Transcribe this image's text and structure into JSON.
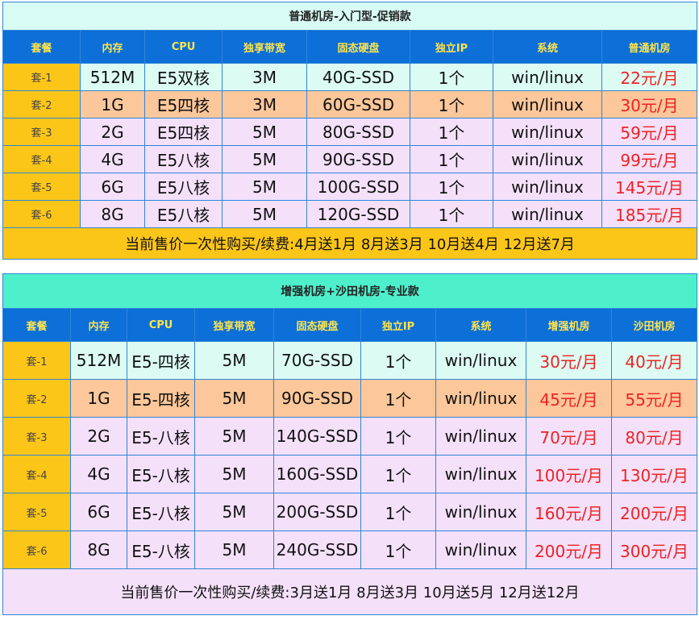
{
  "section1": {
    "title": "普通机房-入门型-促销款",
    "headers": [
      "套餐",
      "内存",
      "CPU",
      "独享带宽",
      "固态硬盘",
      "独立IP",
      "系统",
      "普通机房"
    ],
    "rows": [
      {
        "pkg": "套-1",
        "mem": "512M",
        "cpu": "E5双核",
        "bw": "3M",
        "disk": "40G-SSD",
        "ip": "1个",
        "os": "win/linux",
        "price": "22元/月"
      },
      {
        "pkg": "套-2",
        "mem": "1G",
        "cpu": "E5四核",
        "bw": "3M",
        "disk": "60G-SSD",
        "ip": "1个",
        "os": "win/linux",
        "price": "30元/月"
      },
      {
        "pkg": "套-3",
        "mem": "2G",
        "cpu": "E5四核",
        "bw": "5M",
        "disk": "80G-SSD",
        "ip": "1个",
        "os": "win/linux",
        "price": "59元/月"
      },
      {
        "pkg": "套-4",
        "mem": "4G",
        "cpu": "E5八核",
        "bw": "5M",
        "disk": "90G-SSD",
        "ip": "1个",
        "os": "win/linux",
        "price": "99元/月"
      },
      {
        "pkg": "套-5",
        "mem": "6G",
        "cpu": "E5八核",
        "bw": "5M",
        "disk": "100G-SSD",
        "ip": "1个",
        "os": "win/linux",
        "price": "145元/月"
      },
      {
        "pkg": "套-6",
        "mem": "8G",
        "cpu": "E5八核",
        "bw": "5M",
        "disk": "120G-SSD",
        "ip": "1个",
        "os": "win/linux",
        "price": "185元/月"
      }
    ],
    "footer": "当前售价一次性购买/续费:4月送1月 8月送3月 10月送4月 12月送7月"
  },
  "section2": {
    "title": "增强机房+沙田机房-专业款",
    "headers": [
      "套餐",
      "内存",
      "CPU",
      "独享带宽",
      "固态硬盘",
      "独立IP",
      "系统",
      "增强机房",
      "沙田机房"
    ],
    "rows": [
      {
        "pkg": "套-1",
        "mem": "512M",
        "cpu": "E5-四核",
        "bw": "5M",
        "disk": "70G-SSD",
        "ip": "1个",
        "os": "win/linux",
        "price_a": "30元/月",
        "price_b": "40元/月"
      },
      {
        "pkg": "套-2",
        "mem": "1G",
        "cpu": "E5-四核",
        "bw": "5M",
        "disk": "90G-SSD",
        "ip": "1个",
        "os": "win/linux",
        "price_a": "45元/月",
        "price_b": "55元/月"
      },
      {
        "pkg": "套-3",
        "mem": "2G",
        "cpu": "E5-八核",
        "bw": "5M",
        "disk": "140G-SSD",
        "ip": "1个",
        "os": "win/linux",
        "price_a": "70元/月",
        "price_b": "80元/月"
      },
      {
        "pkg": "套-4",
        "mem": "4G",
        "cpu": "E5-八核",
        "bw": "5M",
        "disk": "160G-SSD",
        "ip": "1个",
        "os": "win/linux",
        "price_a": "100元/月",
        "price_b": "130元/月"
      },
      {
        "pkg": "套-5",
        "mem": "6G",
        "cpu": "E5-八核",
        "bw": "5M",
        "disk": "200G-SSD",
        "ip": "1个",
        "os": "win/linux",
        "price_a": "160元/月",
        "price_b": "200元/月"
      },
      {
        "pkg": "套-6",
        "mem": "8G",
        "cpu": "E5-八核",
        "bw": "5M",
        "disk": "240G-SSD",
        "ip": "1个",
        "os": "win/linux",
        "price_a": "200元/月",
        "price_b": "300元/月"
      }
    ],
    "footer": "当前售价一次性购买/续费:3月送1月 8月送3月 10月送5月 12月送12月"
  },
  "colors": {
    "header_bg": "#0d6fd8",
    "header_text": "#ffe44a",
    "package_bg": "#fcc619",
    "price_text": "#ee2222",
    "row_cyan": "#dcfbf3",
    "row_orange": "#fcc79a",
    "row_pink": "#f5e0fa",
    "section2_title_bg": "#4ef0cb"
  }
}
